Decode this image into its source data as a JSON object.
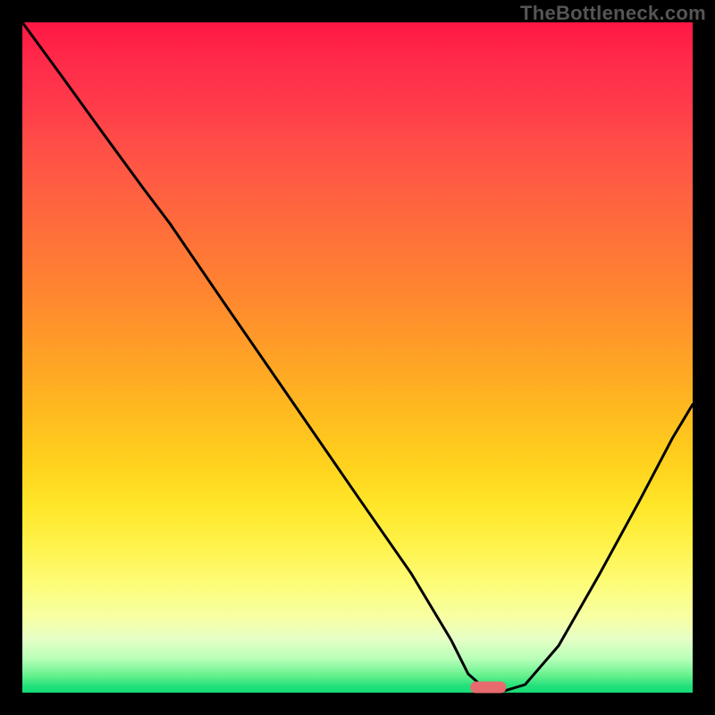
{
  "watermark": "TheBottleneck.com",
  "gradient_colors": {
    "top": "#ff1744",
    "mid_upper": "#ff8a2e",
    "mid": "#ffd21d",
    "mid_lower": "#fdfd7a",
    "bottom": "#15db75"
  },
  "marker": {
    "label": "optimal-range-marker",
    "color": "#e76b6e",
    "x_frac": 0.695,
    "y_frac": 0.992
  },
  "chart_data": {
    "type": "line",
    "title": "",
    "xlabel": "",
    "ylabel": "",
    "xlim": [
      0,
      1
    ],
    "ylim": [
      0,
      1
    ],
    "grid": false,
    "legend": false,
    "description": "V-shaped bottleneck curve over red-to-green vertical gradient; minimum (optimal) around x≈0.68–0.72 at y≈0. Left descending branch has a slope change around x≈0.22. Right branch rises to roughly y≈0.43 at x=1.",
    "series": [
      {
        "name": "bottleneck-curve",
        "x": [
          0.0,
          0.06,
          0.12,
          0.18,
          0.22,
          0.3,
          0.4,
          0.5,
          0.58,
          0.64,
          0.665,
          0.69,
          0.72,
          0.75,
          0.8,
          0.86,
          0.92,
          0.97,
          1.0
        ],
        "y": [
          1.0,
          0.918,
          0.835,
          0.753,
          0.7,
          0.583,
          0.438,
          0.293,
          0.178,
          0.078,
          0.028,
          0.006,
          0.003,
          0.012,
          0.07,
          0.175,
          0.285,
          0.38,
          0.43
        ]
      }
    ]
  }
}
